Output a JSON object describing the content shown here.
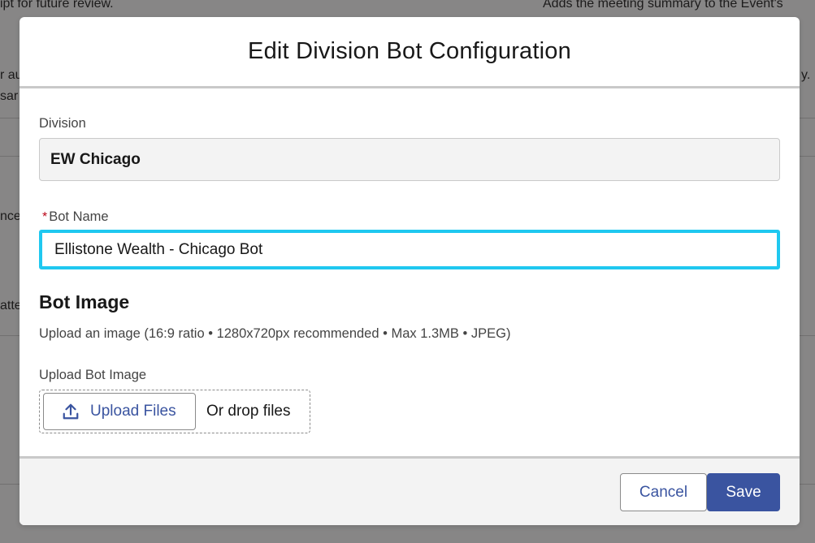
{
  "background": {
    "fragments": [
      "ipt for future review.",
      "Adds the meeting summary to the Event's",
      "r au",
      "y.",
      "sar",
      "nce",
      "atte"
    ]
  },
  "modal": {
    "title": "Edit Division Bot Configuration",
    "division": {
      "label": "Division",
      "value": "EW Chicago"
    },
    "bot_name": {
      "required_marker": "*",
      "label": "Bot Name",
      "value": "Ellistone Wealth - Chicago Bot"
    },
    "bot_image": {
      "heading": "Bot Image",
      "help_text": "Upload an image (16:9 ratio • 1280x720px recommended • Max 1.3MB • JPEG)",
      "upload_label": "Upload Bot Image",
      "upload_button": "Upload Files",
      "drop_text": "Or drop files",
      "upload_icon": "upload-icon"
    },
    "footer": {
      "cancel_label": "Cancel",
      "save_label": "Save"
    }
  },
  "colors": {
    "brand": "#3a54a0",
    "focus_ring": "#1fc8f0",
    "required": "#ba0517"
  }
}
